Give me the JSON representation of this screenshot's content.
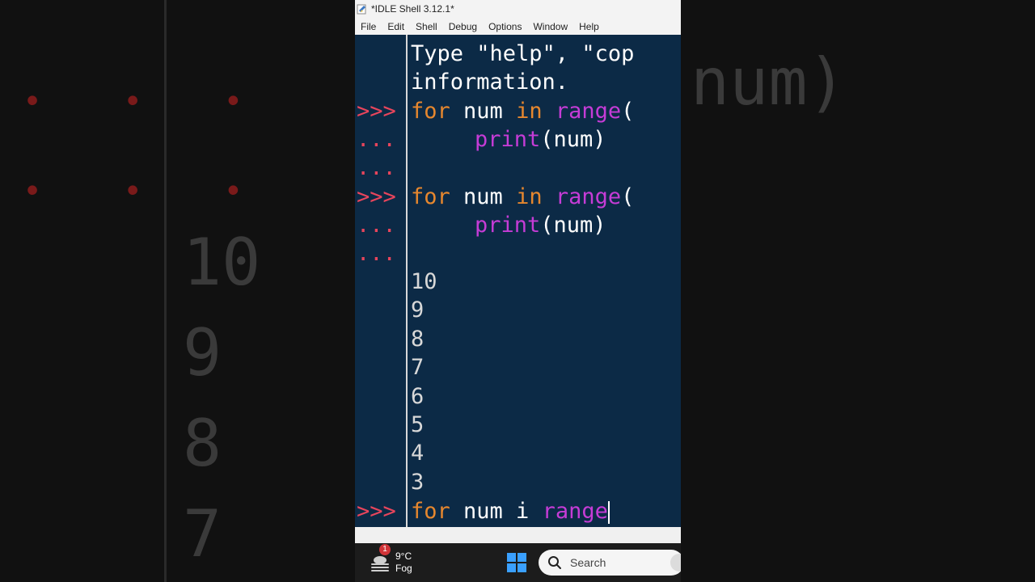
{
  "window": {
    "title": "*IDLE Shell 3.12.1*"
  },
  "menu": [
    "File",
    "Edit",
    "Shell",
    "Debug",
    "Options",
    "Window",
    "Help"
  ],
  "shell": {
    "prompt": ">>>",
    "continuation": "...",
    "intro_line1": "Type \"help\", \"cop",
    "intro_line2": "information.",
    "block1": {
      "kw_for": "for",
      "var": " num ",
      "kw_in": "in",
      "space": " ",
      "func": "range",
      "paren": "(",
      "body_func": "print",
      "body_rest": "(num)"
    },
    "block2": {
      "kw_for": "for",
      "var": " num ",
      "kw_in": "in",
      "space": " ",
      "func": "range",
      "paren": "(",
      "body_func": "print",
      "body_rest": "(num)"
    },
    "output": [
      "10",
      "9",
      "8",
      "7",
      "6",
      "5",
      "4",
      "3"
    ],
    "current": {
      "kw_for": "for",
      "text": " num i ",
      "func": "range"
    }
  },
  "taskbar": {
    "weather_temp": "9°C",
    "weather_desc": "Fog",
    "badge_count": "1",
    "search_label": "Search"
  },
  "background": {
    "left_numbers": [
      "10",
      "9",
      "8",
      "7"
    ],
    "right_text": "num)"
  },
  "colors": {
    "shell_bg": "#0c2a46",
    "prompt": "#e8455c",
    "keyword": "#e6872e",
    "builtin": "#c53cd6",
    "output": "#d8d8d8"
  }
}
